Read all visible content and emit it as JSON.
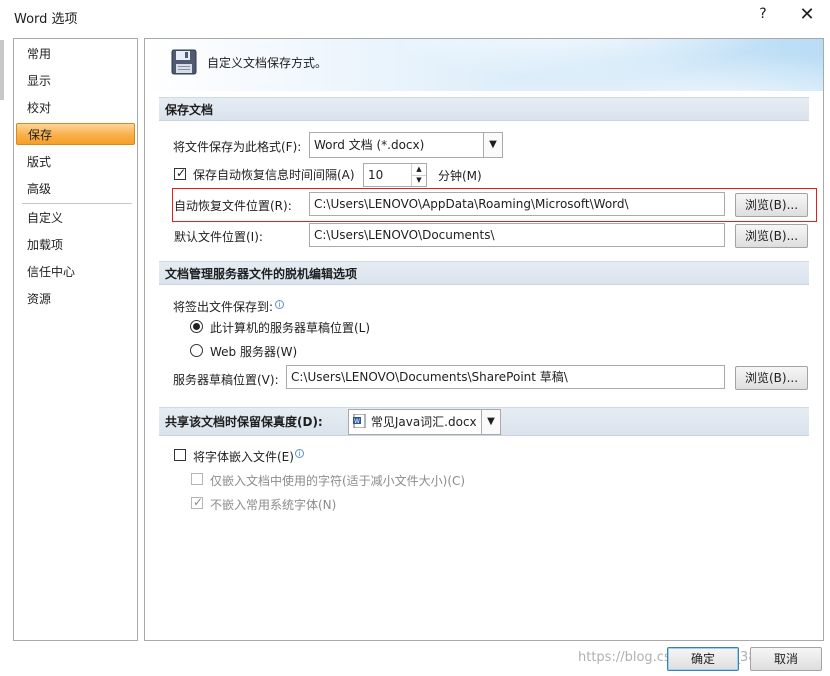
{
  "window": {
    "title": "Word 选项",
    "help": "?",
    "close": "✕"
  },
  "sidebar": {
    "items": [
      {
        "label": "常用"
      },
      {
        "label": "显示"
      },
      {
        "label": "校对"
      },
      {
        "label": "保存"
      },
      {
        "label": "版式"
      },
      {
        "label": "高级"
      },
      {
        "label": "自定义"
      },
      {
        "label": "加载项"
      },
      {
        "label": "信任中心"
      },
      {
        "label": "资源"
      }
    ],
    "active_index": 3
  },
  "banner": {
    "text": "自定义文档保存方式。",
    "icon": "floppy-disk-icon"
  },
  "save_docs": {
    "header": "保存文档",
    "format_label": "将文件保存为此格式(F):",
    "format_value": "Word 文档 (*.docx)",
    "autorecover_checkbox_label": "保存自动恢复信息时间间隔(A)",
    "autorecover_checked": true,
    "autorecover_minutes": "10",
    "minutes_label": "分钟(M)",
    "autorecover_location_label": "自动恢复文件位置(R):",
    "autorecover_location_value": "C:\\Users\\LENOVO\\AppData\\Roaming\\Microsoft\\Word\\",
    "default_location_label": "默认文件位置(I):",
    "default_location_value": "C:\\Users\\LENOVO\\Documents\\",
    "browse_label": "浏览(B)..."
  },
  "offline": {
    "header": "文档管理服务器文件的脱机编辑选项",
    "checkout_label": "将签出文件保存到:",
    "option_local": "此计算机的服务器草稿位置(L)",
    "option_web": "Web 服务器(W)",
    "selected": "local",
    "drafts_label": "服务器草稿位置(V):",
    "drafts_value": "C:\\Users\\LENOVO\\Documents\\SharePoint 草稿\\",
    "browse_label": "浏览(B)..."
  },
  "fidelity": {
    "header": "共享该文档时保留保真度(D):",
    "document_value": "常见Java词汇.docx",
    "embed_fonts_label": "将字体嵌入文件(E)",
    "embed_fonts_checked": false,
    "embed_used_chars_label": "仅嵌入文档中使用的字符(适于减小文件大小)(C)",
    "embed_used_chars_checked": false,
    "no_common_fonts_label": "不嵌入常用系统字体(N)",
    "no_common_fonts_checked": true
  },
  "footer": {
    "ok_label": "确定",
    "cancel_label": "取消",
    "watermark": "https://blog.csdn.net/qq_38917 04"
  },
  "colors": {
    "active_nav": "#f8b049",
    "highlight_border": "#e02020",
    "section_header": "#dae3ed"
  }
}
